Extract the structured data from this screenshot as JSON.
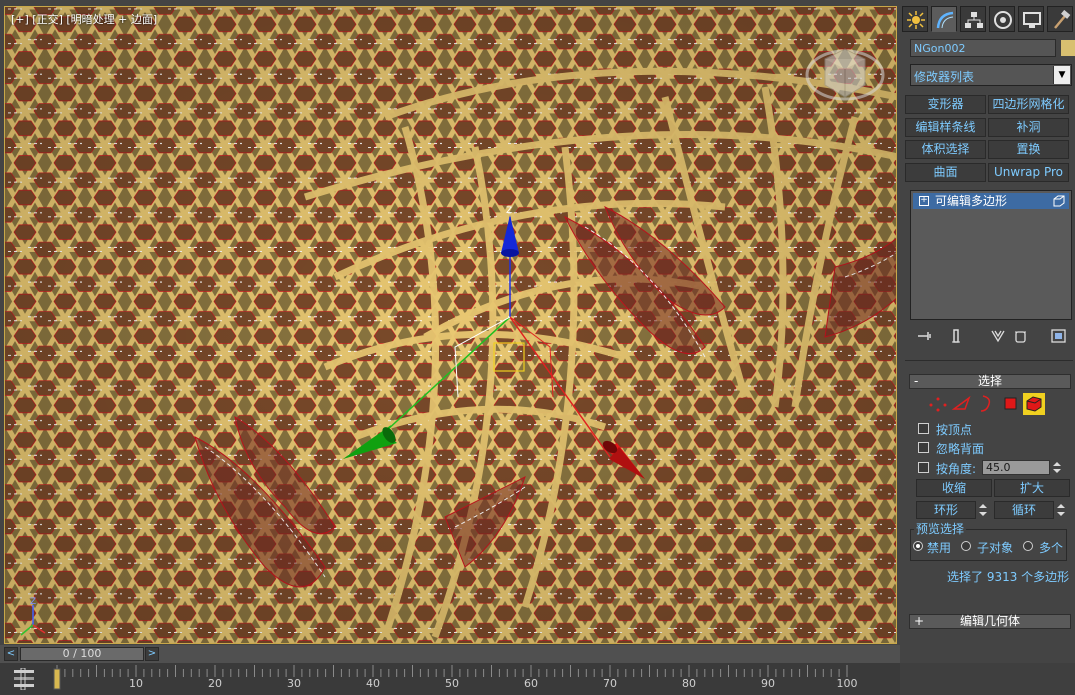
{
  "viewport": {
    "label": "[+] [正交] [明暗处理 + 边面]",
    "axis_z_label": "Z",
    "mini_axis_label": "Z"
  },
  "command_panel": {
    "tabs": [
      {
        "name": "create-tab",
        "icon": "sun-icon"
      },
      {
        "name": "modify-tab",
        "icon": "modify-arc-icon",
        "active": true
      },
      {
        "name": "hierarchy-tab",
        "icon": "hierarchy-icon"
      },
      {
        "name": "motion-tab",
        "icon": "motion-icon"
      },
      {
        "name": "display-tab",
        "icon": "monitor-icon"
      },
      {
        "name": "utilities-tab",
        "icon": "hammer-icon"
      }
    ],
    "object_name": "NGon002",
    "object_color": "#d8c070",
    "modifier_list_label": "修改器列表",
    "modifier_buttons": [
      "变形器",
      "四边形网格化",
      "编辑样条线",
      "补洞",
      "体积选择",
      "置换",
      "曲面",
      "Unwrap Pro"
    ],
    "stack_item": "可编辑多边形"
  },
  "selection": {
    "title": "选择",
    "by_vertex": "按顶点",
    "ignore_backfacing": "忽略背面",
    "by_angle": "按角度:",
    "angle_value": "45.0",
    "shrink": "收缩",
    "grow": "扩大",
    "ring": "环形",
    "loop": "循环",
    "preview_title": "预览选择",
    "preview_off": "禁用",
    "preview_subobject": "子对象",
    "preview_multi": "多个",
    "status": "选择了 9313 个多边形"
  },
  "edit_geometry": {
    "title": "编辑几何体"
  },
  "timeline": {
    "frame_display": "0 / 100",
    "prev": "<",
    "next": ">",
    "ticks": [
      "10",
      "20",
      "30",
      "40",
      "50",
      "60",
      "70",
      "80",
      "90",
      "100"
    ]
  },
  "colors": {
    "accent_text": "#7ecbff",
    "mesh_fill": "#8e7a3e",
    "weave_strip": "#e9c872",
    "edge_red": "#c8141e",
    "selected_blue": "#3d6ba3"
  }
}
